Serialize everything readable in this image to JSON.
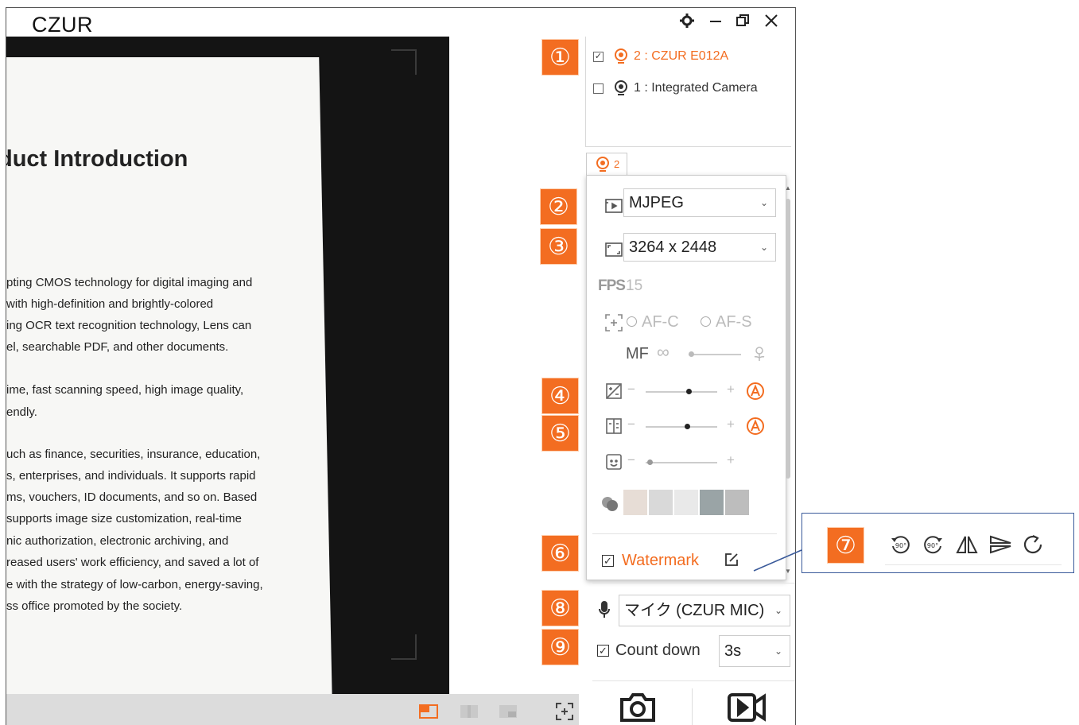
{
  "app": {
    "title": "CZUR",
    "window_controls": [
      "settings-icon",
      "minimize-icon",
      "restore-icon",
      "close-icon"
    ]
  },
  "preview": {
    "heading": "duct Introduction",
    "lines": [
      "pting CMOS technology for digital imaging and",
      " with high-definition and brightly-colored",
      "ing OCR text recognition technology, Lens can",
      "el, searchable PDF, and other documents.",
      "ime, fast scanning speed, high image quality,",
      "endly.",
      "uch as finance, securities, insurance, education,",
      "s, enterprises, and individuals. It supports rapid",
      "ms, vouchers, ID documents, and so on. Based",
      " supports image size customization, real-time",
      "nic authorization, electronic archiving, and",
      "reased users' work efficiency, and saved a lot of",
      "e with the strategy of low-carbon, energy-saving,",
      "ss office promoted by the society."
    ]
  },
  "cameras": [
    {
      "label": "2 : CZUR E012A",
      "checked": true,
      "color": "#f36d21"
    },
    {
      "label": "1 : Integrated Camera",
      "checked": false,
      "color": "#333333"
    }
  ],
  "camera_tab": {
    "label": "2"
  },
  "settings": {
    "format": "MJPEG",
    "resolution": "3264 x 2448",
    "fps_label": "FPS",
    "fps_value": "15",
    "af_c": "AF-C",
    "af_s": "AF-S",
    "mf": "MF",
    "infinity": "∞",
    "minus": "−",
    "plus": "+",
    "brightness_level": 0.6,
    "contrast_level": 0.58,
    "beauty_level": 0.05,
    "watermark_label": "Watermark",
    "watermark_checked": true
  },
  "rotate_tools": {
    "ccw": "90°",
    "cw": "90°"
  },
  "audio": {
    "mic": "マイク (CZUR MIC)"
  },
  "countdown": {
    "label": "Count down",
    "value": "3s"
  },
  "badges": [
    "①",
    "②",
    "③",
    "④",
    "⑤",
    "⑥",
    "⑦",
    "⑧",
    "⑨"
  ],
  "colors": {
    "accent": "#f36d21",
    "callout_border": "#3a5a9a"
  }
}
